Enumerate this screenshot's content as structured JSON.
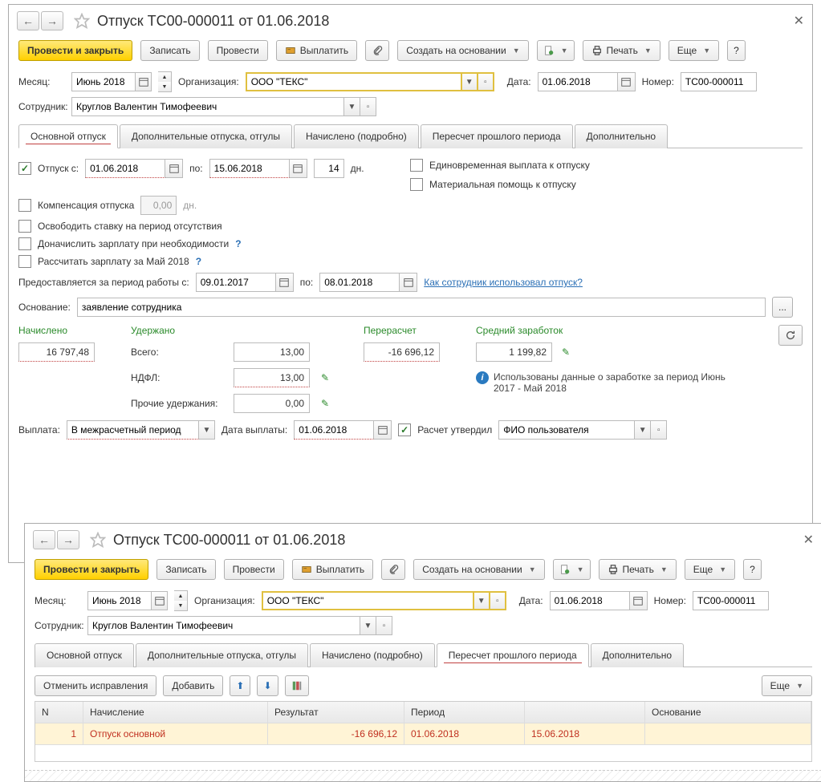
{
  "title": "Отпуск ТС00-000011 от 01.06.2018",
  "toolbar": {
    "post_close": "Провести и закрыть",
    "save": "Записать",
    "post": "Провести",
    "pay": "Выплатить",
    "create_based": "Создать на основании",
    "print": "Печать",
    "more": "Еще",
    "help": "?"
  },
  "header": {
    "month_lbl": "Месяц:",
    "month_val": "Июнь 2018",
    "org_lbl": "Организация:",
    "org_val": "ООО \"ТЕКС\"",
    "date_lbl": "Дата:",
    "date_val": "01.06.2018",
    "num_lbl": "Номер:",
    "num_val": "ТС00-000011",
    "emp_lbl": "Сотрудник:",
    "emp_val": "Круглов Валентин Тимофеевич"
  },
  "tabs": {
    "t1": "Основной отпуск",
    "t2": "Дополнительные отпуска, отгулы",
    "t3": "Начислено (подробно)",
    "t4": "Пересчет прошлого периода",
    "t5": "Дополнительно"
  },
  "main_tab": {
    "leave_lbl": "Отпуск  c:",
    "from": "01.06.2018",
    "to_lbl": "по:",
    "to": "15.06.2018",
    "days": "14",
    "days_lbl": "дн.",
    "lump_sum": "Единовременная выплата к отпуску",
    "mat_help": "Материальная помощь к отпуску",
    "comp_lbl": "Компенсация отпуска",
    "comp_val": "0,00",
    "comp_days": "дн.",
    "free_rate": "Освободить ставку на период отсутствия",
    "add_salary": "Доначислить зарплату при необходимости",
    "calc_salary": "Рассчитать зарплату за Май 2018",
    "period_lbl": "Предоставляется за период работы с:",
    "period_from": "09.01.2017",
    "period_to_lbl": "по:",
    "period_to": "08.01.2018",
    "how_used": "Как сотрудник использовал отпуск?",
    "reason_lbl": "Основание:",
    "reason_val": "заявление сотрудника",
    "accrued_lbl": "Начислено",
    "accrued_val": "16 797,48",
    "withheld_lbl": "Удержано",
    "total_lbl": "Всего:",
    "total_val": "13,00",
    "ndfl_lbl": "НДФЛ:",
    "ndfl_val": "13,00",
    "other_lbl": "Прочие удержания:",
    "other_val": "0,00",
    "recalc_lbl": "Перерасчет",
    "recalc_val": "-16 696,12",
    "avg_lbl": "Средний заработок",
    "avg_val": "1 199,82",
    "info_text": "Использованы данные о заработке за период Июнь 2017 - Май 2018",
    "payout_lbl": "Выплата:",
    "payout_val": "В межрасчетный период",
    "payout_date_lbl": "Дата выплаты:",
    "payout_date": "01.06.2018",
    "approved_lbl": "Расчет утвердил",
    "approved_by": "ФИО пользователя"
  },
  "recalc_tab": {
    "cancel_fix": "Отменить исправления",
    "add": "Добавить",
    "more": "Еще",
    "col_n": "N",
    "col_accrual": "Начисление",
    "col_result": "Результат",
    "col_period": "Период",
    "col_reason": "Основание",
    "rows": [
      {
        "n": "1",
        "accrual": "Отпуск основной",
        "result": "-16 696,12",
        "period_from": "01.06.2018",
        "period_to": "15.06.2018",
        "reason": ""
      }
    ]
  }
}
